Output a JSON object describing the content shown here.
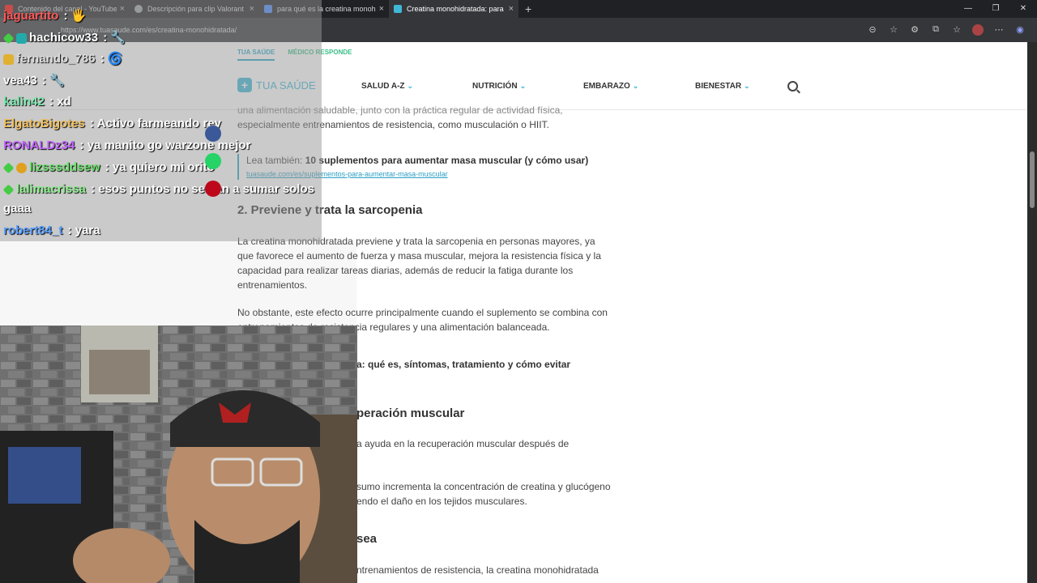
{
  "browser": {
    "tabs": [
      {
        "title": "Contenido del canal - YouTube St",
        "color": "#ff0000"
      },
      {
        "title": "Descripción para clip Valorant",
        "color": "#9aa0a6"
      },
      {
        "title": "para qué es la creatina monohidr",
        "color": "#4285f4"
      },
      {
        "title": "Creatina monohidratada: para qu",
        "color": "#3fb8d6"
      }
    ],
    "new_tab_symbol": "+",
    "url": "https://www.tuasaude.com/es/creatina-monohidratada/"
  },
  "site": {
    "top_links": [
      "TUA SAÚDE",
      "MÉDICO RESPONDE"
    ],
    "logo_text": "TUA SAÚDE",
    "nav": [
      "SALUD A-Z",
      "NUTRICIÓN",
      "EMBARAZO",
      "BIENESTAR"
    ]
  },
  "article": {
    "p_top_1": "una alimentación saludable, junto con la práctica regular de actividad física,",
    "p_top_2": "especialmente entrenamientos de resistencia, como musculación o HIIT.",
    "lea_label": "Lea también:",
    "lea_title": "10 suplementos para aumentar masa muscular (y cómo usar)",
    "lea_url": "tuasaude.com/es/suplementos-para-aumentar-masa-muscular",
    "h2_sarcopenia": "2. Previene y trata la sarcopenia",
    "p_sarc_1": "La creatina monohidratada previene y trata la sarcopenia en personas mayores, ya",
    "p_sarc_2": "que favorece el aumento de fuerza y masa muscular, mejora la resistencia física y la",
    "p_sarc_3": "capacidad para realizar tareas diarias, además de reducir la fatiga durante los",
    "p_sarc_4": "entrenamientos.",
    "p_obst_1": "No obstante, este efecto ocurre principalmente cuando el suplemento se combina con",
    "p_obst_2": "entrenamientos de resistencia regulares y una alimentación balanceada.",
    "lea2_title": "a: qué es, síntomas, tratamiento y cómo evitar",
    "h2_recup": "peración muscular",
    "p_rec_1": "a ayuda en la recuperación muscular después de",
    "p_rec_2": "sumo incrementa la concentración de creatina y glucógeno",
    "p_rec_3": "endo el daño en los tejidos musculares.",
    "h2_osea": "sea",
    "p_osea_1": "ntrenamientos de resistencia, la creatina monohidratada"
  },
  "chat": [
    {
      "user": "jaguartito",
      "text": "🖐",
      "color": "#ff5a5a"
    },
    {
      "user": "hachicow33",
      "text": "🔧",
      "color": "#ffffff"
    },
    {
      "user": "fernando_786",
      "text": "🌀",
      "color": "#dddddd"
    },
    {
      "user": "vea43",
      "text": "🔧",
      "color": "#ffffff"
    },
    {
      "user": "kalin42",
      "text": "xd",
      "color": "#7ee8b0"
    },
    {
      "user": "ElgatoBigotes",
      "text": "Activo farmeando rey",
      "color": "#f0c060"
    },
    {
      "user": "RONALDz34",
      "text": "ya manito go warzone mejor",
      "color": "#c266ff"
    },
    {
      "user": "lizsssddsew",
      "text": "ya quiero mi orito",
      "color": "#6ee06e"
    },
    {
      "user": "lalimacrissa",
      "text": "esos puntos no se van a sumar solos",
      "continuation": "gaaa",
      "color": "#8ef08e"
    },
    {
      "user": "robert84_t",
      "text": "yara",
      "color": "#5aa0ff"
    }
  ],
  "colors": {
    "brand": "#3fb8d6",
    "link": "#2a9fc4",
    "chrome_dark": "#202124"
  }
}
